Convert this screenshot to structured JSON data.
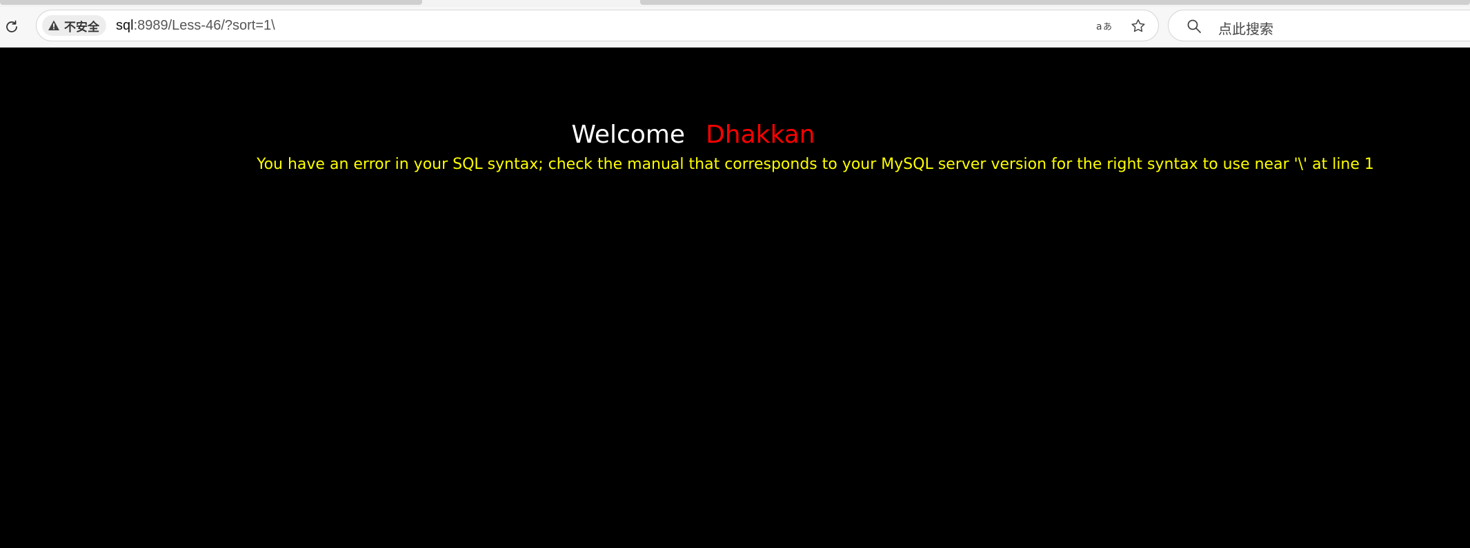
{
  "browser": {
    "security_label": "不安全",
    "url_host": "sql",
    "url_rest": ":8989/Less-46/?sort=1\\",
    "search_placeholder": "点此搜索",
    "icons": {
      "reload": "reload-icon",
      "warning": "warning-icon",
      "translate": "translate-icon",
      "favorite": "star-icon",
      "search": "search-icon"
    }
  },
  "page": {
    "welcome_label": "Welcome",
    "user_name": "Dhakkan",
    "error_message": "You have an error in your SQL syntax; check the manual that corresponds to your MySQL server version for the right syntax to use near '\\' at line 1",
    "colors": {
      "background": "#000000",
      "welcome": "#ffffff",
      "name": "#ff0000",
      "error": "#ffff00"
    }
  }
}
